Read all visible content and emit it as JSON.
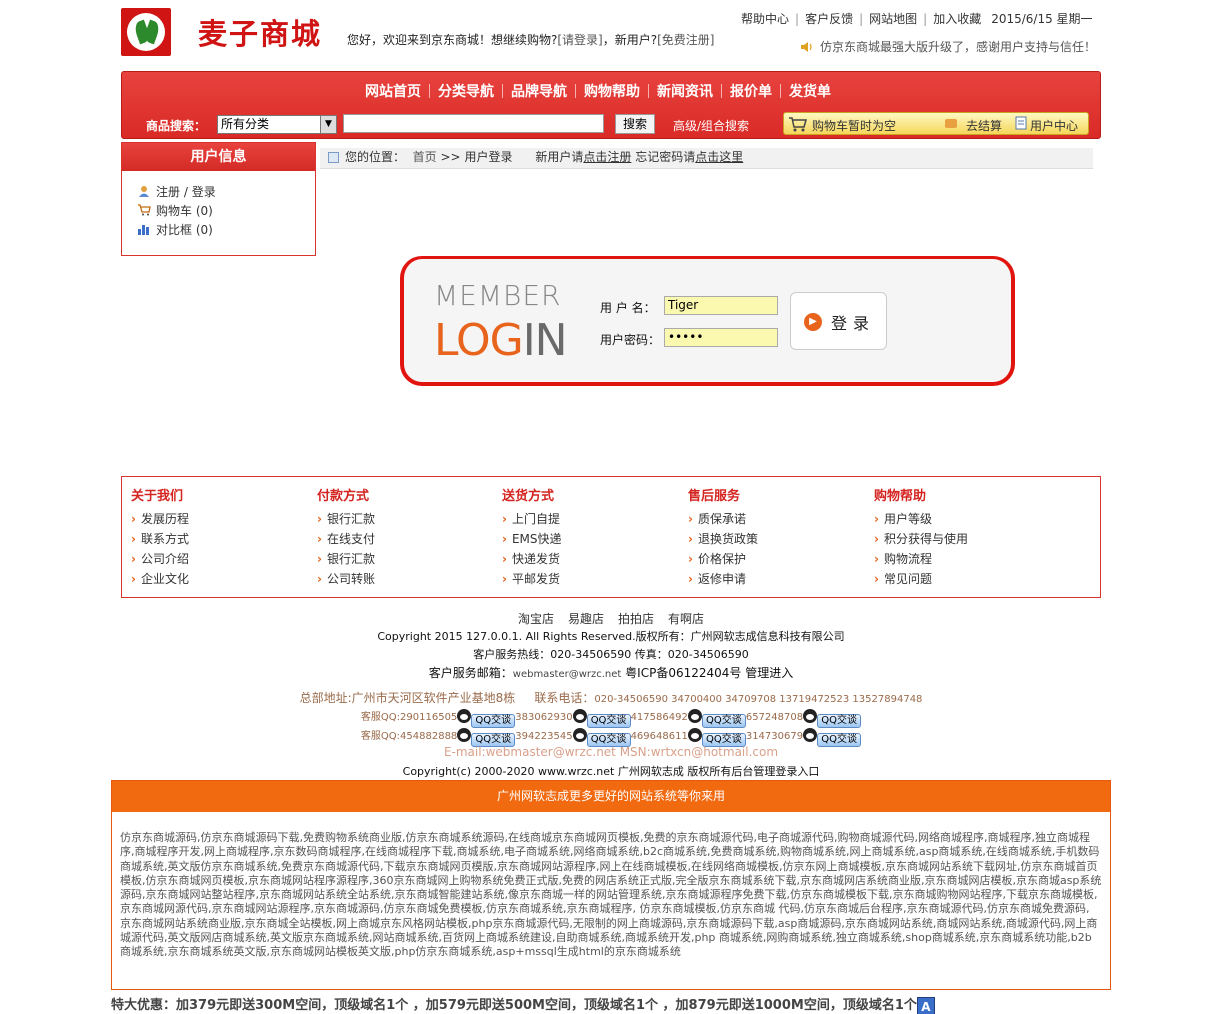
{
  "header": {
    "logo_text": "麦子商城",
    "welcome_text": "您好，欢迎来到京东商城！想继续购物?",
    "login_link": "[请登录]",
    "new_user_text": "，新用户?",
    "register_link": "[免费注册]",
    "top_links": [
      "帮助中心",
      "客户反馈",
      "网站地图",
      "加入收藏"
    ],
    "date": "2015/6/15 星期一",
    "notice": "仿京东商城最强大版升级了，感谢用户支持与信任！"
  },
  "nav": {
    "items": [
      "网站首页",
      "分类导航",
      "品牌导航",
      "购物帮助",
      "新闻资讯",
      "报价单",
      "发货单"
    ],
    "search_label": "商品搜索：",
    "category_selected": "所有分类",
    "search_button": "搜索",
    "advanced_search": "高级/组合搜索",
    "cart_status": "购物车暂时为空",
    "checkout": "去结算",
    "user_center": "用户中心"
  },
  "sidebar": {
    "title": "用户信息",
    "register": "注册",
    "login": "登录",
    "cart": "购物车 (0)",
    "compare": "对比框 (0)"
  },
  "breadcrumb": {
    "prefix": "您的位置：",
    "home": "首页",
    "sep": ">>",
    "current": "用户登录",
    "new_user": "新用户请",
    "register_here": "点击注册",
    "forgot": "忘记密码请",
    "click_here": "点击这里"
  },
  "login": {
    "member_text": "MEMBER",
    "login_lo": "LOG",
    "login_in": "IN",
    "username_label": "用 户 名：",
    "username_value": "Tiger",
    "password_label": "用户密码：",
    "password_value": "•••••",
    "submit_label": "登录"
  },
  "footer_columns": [
    {
      "title": "关于我们",
      "items": [
        "发展历程",
        "联系方式",
        "公司介绍",
        "企业文化"
      ]
    },
    {
      "title": "付款方式",
      "items": [
        "银行汇款",
        "在线支付",
        "银行汇款",
        "公司转账"
      ]
    },
    {
      "title": "送货方式",
      "items": [
        "上门自提",
        "EMS快递",
        "快递发货",
        "平邮发货"
      ]
    },
    {
      "title": "售后服务",
      "items": [
        "质保承诺",
        "退换货政策",
        "价格保护",
        "返修申请"
      ]
    },
    {
      "title": "购物帮助",
      "items": [
        "用户等级",
        "积分获得与使用",
        "购物流程",
        "常见问题"
      ]
    }
  ],
  "bottom": {
    "shops": [
      "淘宝店",
      "易趣店",
      "拍拍店",
      "有啊店"
    ],
    "copyright": "Copyright 2015 127.0.0.1. All Rights Reserved.版权所有：广州网软志成信息科技有限公司",
    "hotline": "客户服务热线：020-34506590   传真：020-34506590",
    "email_label": "客户服务邮箱：",
    "email": "webmaster@wrzc.net",
    "icp": "粤ICP备06122404号",
    "admin": "管理进入",
    "address": "总部地址:广州市天河区软件产业基地8栋",
    "phones_label": "联系电话：",
    "phones": "020-34506590 34700400 34709708 13719472523 13527894748",
    "qq_label": "客服QQ:",
    "qq_row1": [
      "290116505",
      "383062930",
      "417586492",
      "657248708"
    ],
    "qq_row2": [
      "454882888",
      "394223545",
      "469648611",
      "314730679"
    ],
    "qq_button": "QQ交谈",
    "email_msn": "E-mail:webmaster@wrzc.net MSN:wrtxcn@hotmail.com",
    "copyright2": "Copyright(c) 2000-2020 www.wrzc.net 广州网软志成 版权所有后台管理登录入口"
  },
  "orange_box": {
    "title": "广州网软志成更多更好的网站系统等你来用",
    "body": "仿京东商城源码,仿京东商城源码下载,免费购物系统商业版,仿京东商城系统源码,在线商城京东商城网页模板,免费的京东商城源代码,电子商城源代码,购物商城源代码,网络商城程序,商城程序,独立商城程序,商城程序开发,网上商城程序,京东数码商城程序,在线商城程序下载,商城系统,电子商城系统,网络商城系统,b2c商城系统,免费商城系统,购物商城系统,网上商城系统,asp商城系统,在线商城系统,手机数码商城系统,英文版仿京东商城系统,免费京东商城源代码,下载京东商城网页模版,京东商城网站源程序,网上在线商城模板,在线网络商城模板,仿京东网上商城模板,京东商城网站系统下载网址,仿京东商城首页模板,仿京东商城网页模板,京东商城网站程序源程序,360京东商城网上购物系统免费正式版,免费的网店系统正式版,完全版京东商城系统下载,京东商城网店系统商业版,京东商城网店模板,京东商城asp系统源码,京东商城网站整站程序,京东商城网站系统全站系统,京东商城智能建站系统,像京东商城一样的网站管理系统,京东商城源程序免费下载,仿京东商城模板下载,京东商城购物网站程序,下载京东商城模板,京东商城网源代码,京东商城网站源程序,京东商城源码,仿京东商城免费模板,仿京东商城系统,京东商城程序, 仿京东商城模板,仿京东商城 代码,仿京东商城后台程序,京东商城源代码,仿京东商城免费源码, 京东商城网站系统商业版,京东商城全站模板,网上商城京东风格网站模板,php京东商城源代码,无限制的网上商城源码,京东商城源码下载,asp商城源码,京东商城网站系统,商城网站系统,商城源代码,网上商城源代码,英文版网店商城系统,英文版京东商城系统,网站商城系统,百货网上商城系统建设,自助商城系统,商城系统开发,php 商城系统,网购商城系统,独立商城系统,shop商城系统,京东商城系统功能,b2b商城系统,京东商城系统英文版,京东商城网站模板英文版,php仿京东商城系统,asp+mssql生成html的京东商城系统"
  },
  "promo": {
    "text": "特大优惠：加379元即送300M空间，顶级域名1个 ，加579元即送500M空间，顶级域名1个 ，加879元即送1000M空间，顶级域名1个",
    "icon_label": "A"
  }
}
